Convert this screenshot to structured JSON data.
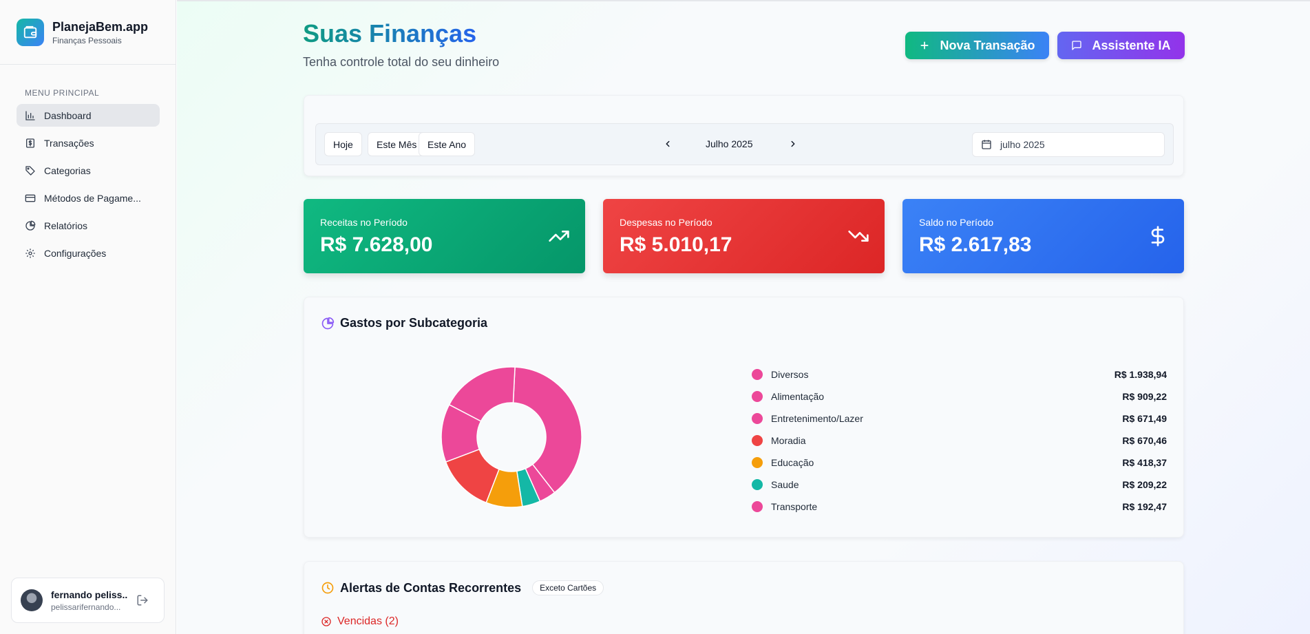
{
  "brand": {
    "name": "PlanejaBem.app",
    "subtitle": "Finanças Pessoais"
  },
  "sidebar": {
    "section_title": "MENU PRINCIPAL",
    "items": [
      {
        "label": "Dashboard",
        "icon": "bar-chart-icon",
        "active": true
      },
      {
        "label": "Transações",
        "icon": "dollar-receipt-icon"
      },
      {
        "label": "Categorias",
        "icon": "tag-icon"
      },
      {
        "label": "Métodos de Pagame...",
        "icon": "credit-card-icon"
      },
      {
        "label": "Relatórios",
        "icon": "pie-chart-icon"
      },
      {
        "label": "Configurações",
        "icon": "gear-icon"
      }
    ]
  },
  "user": {
    "name": "fernando peliss...",
    "email": "pelissarifernando..."
  },
  "header": {
    "title": "Suas Finanças",
    "subtitle": "Tenha controle total do seu dinheiro",
    "new_transaction": "Nova Transação",
    "assistant": "Assistente IA"
  },
  "filters": {
    "today": "Hoje",
    "this_month": "Este Mês",
    "this_year": "Este Ano",
    "period": "Julho 2025",
    "date_value": "julho 2025"
  },
  "stats": {
    "income_label": "Receitas no Período",
    "income_value": "R$ 7.628,00",
    "expense_label": "Despesas no Período",
    "expense_value": "R$ 5.010,17",
    "balance_label": "Saldo no Período",
    "balance_value": "R$ 2.617,83"
  },
  "colors": {
    "pink": "#ec4899",
    "red": "#ef4444",
    "amber": "#f59e0b",
    "teal": "#14b8a6"
  },
  "chart_data": {
    "type": "pie",
    "title": "Gastos por Subcategoria",
    "categories": [
      "Diversos",
      "Alimentação",
      "Entretenimento/Lazer",
      "Moradia",
      "Educação",
      "Saude",
      "Transporte"
    ],
    "values": [
      1938.94,
      909.22,
      671.49,
      670.46,
      418.37,
      209.22,
      192.47
    ],
    "value_labels": [
      "R$ 1.938,94",
      "R$ 909,22",
      "R$ 671,49",
      "R$ 670,46",
      "R$ 418,37",
      "R$ 209,22",
      "R$ 192,47"
    ],
    "colors": [
      "#ec4899",
      "#ec4899",
      "#ec4899",
      "#ef4444",
      "#f59e0b",
      "#14b8a6",
      "#ec4899"
    ],
    "donut": true
  },
  "alerts": {
    "title": "Alertas de Contas Recorrentes",
    "badge": "Exceto Cartões",
    "overdue": "Vencidas (2)"
  }
}
